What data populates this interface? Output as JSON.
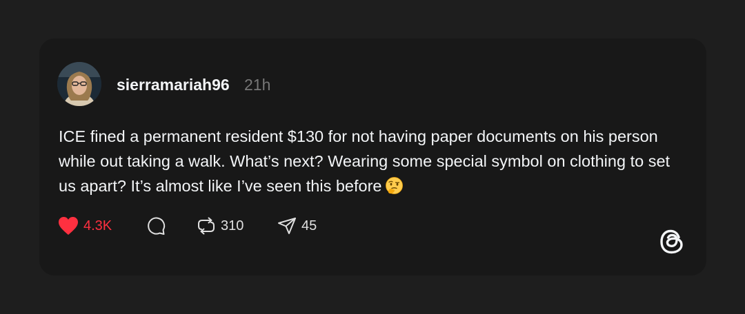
{
  "post": {
    "username": "sierramariah96",
    "timestamp": "21h",
    "text": "ICE fined a permanent resident $130 for not having paper documents on his person while out taking a walk. What’s next? Wearing some special symbol on clothing to set us apart? It’s almost like I’ve seen this before",
    "emoji": "thinking-face-with-raised-eyebrow"
  },
  "actions": {
    "like": {
      "count": "4.3K",
      "icon": "heart-filled-icon",
      "color": "#ff3040"
    },
    "reply": {
      "icon": "comment-bubble-icon"
    },
    "repost": {
      "count": "310",
      "icon": "repost-icon"
    },
    "share": {
      "count": "45",
      "icon": "send-icon"
    }
  },
  "branding": {
    "logo": "threads-logo-icon"
  },
  "colors": {
    "background": "#1e1e1e",
    "card": "#181818",
    "text": "#f3f5f7",
    "muted": "#777777",
    "like": "#ff3040"
  }
}
